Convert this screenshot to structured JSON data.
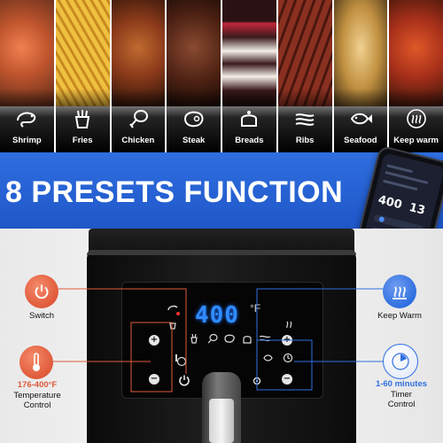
{
  "presets": [
    {
      "label": "Shrimp",
      "icon": "shrimp-icon",
      "photo_color": "#b85a35"
    },
    {
      "label": "Fries",
      "icon": "fries-icon",
      "photo_color": "#d9a030"
    },
    {
      "label": "Chicken",
      "icon": "chicken-leg-icon",
      "photo_color": "#8a3a1a"
    },
    {
      "label": "Steak",
      "icon": "steak-icon",
      "photo_color": "#5a2a18"
    },
    {
      "label": "Breads",
      "icon": "cake-icon",
      "photo_color": "#3b1a1c"
    },
    {
      "label": "Ribs",
      "icon": "ribs-icon",
      "photo_color": "#7a2a20"
    },
    {
      "label": "Seafood",
      "icon": "fish-icon",
      "photo_color": "#c08a40"
    },
    {
      "label": "Keep warm",
      "icon": "steam-icon",
      "photo_color": "#b03a20"
    }
  ],
  "banner": {
    "title": "8 PRESETS FUNCTION"
  },
  "phone": {
    "temperature": "400",
    "time": "13"
  },
  "panel": {
    "display_value": "400",
    "display_unit": "°F"
  },
  "callouts": {
    "switch": {
      "label": "Switch",
      "color": "#e05a3a"
    },
    "temperature": {
      "range": "176-400°F",
      "label_line1": "Temperature",
      "label_line2": "Control",
      "range_color": "#e05a3a"
    },
    "keep_warm": {
      "label": "Keep Warm",
      "color": "#2f6fe0"
    },
    "timer": {
      "range": "1-60 minutes",
      "label_line1": "Timer",
      "label_line2": "Control",
      "range_color": "#2f6fe0"
    }
  },
  "colors": {
    "accent_red": "#e05a3a",
    "accent_blue": "#2f6fe0",
    "display_blue": "#2f8cff"
  }
}
